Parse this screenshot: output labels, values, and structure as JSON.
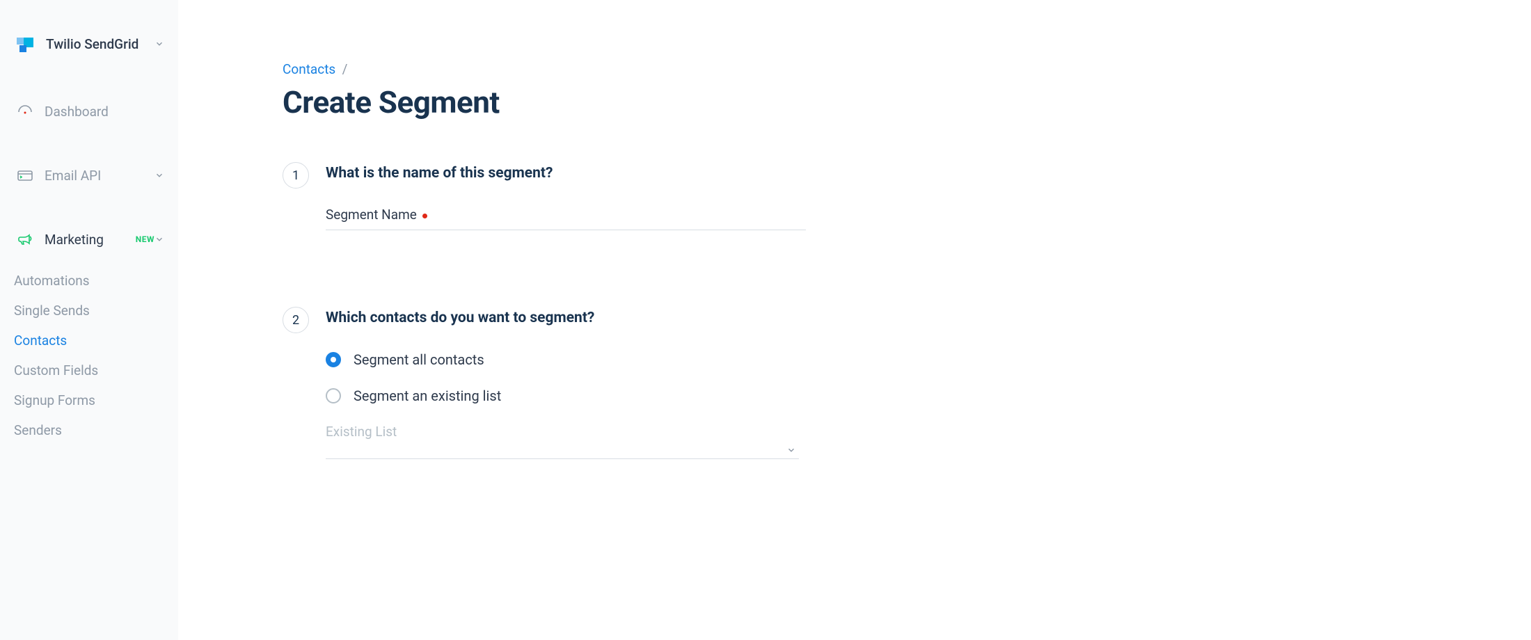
{
  "brand": {
    "name": "Twilio SendGrid"
  },
  "sidebar": {
    "items": [
      {
        "label": "Dashboard"
      },
      {
        "label": "Email API"
      },
      {
        "label": "Marketing",
        "badge": "NEW"
      }
    ],
    "subitems": [
      {
        "label": "Automations"
      },
      {
        "label": "Single Sends"
      },
      {
        "label": "Contacts"
      },
      {
        "label": "Custom Fields"
      },
      {
        "label": "Signup Forms"
      },
      {
        "label": "Senders"
      }
    ]
  },
  "breadcrumb": {
    "parent": "Contacts",
    "sep": "/"
  },
  "page": {
    "title": "Create Segment"
  },
  "steps": {
    "one": {
      "num": "1",
      "question": "What is the name of this segment?",
      "field_label": "Segment Name"
    },
    "two": {
      "num": "2",
      "question": "Which contacts do you want to segment?",
      "option_all": "Segment all contacts",
      "option_list": "Segment an existing list",
      "existing_label": "Existing List"
    }
  }
}
